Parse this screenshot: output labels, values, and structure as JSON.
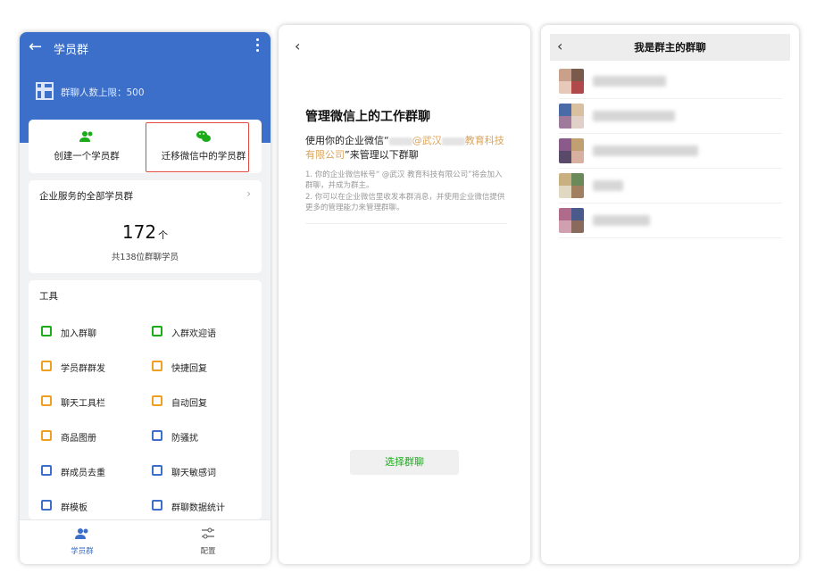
{
  "panel1": {
    "title": "学员群",
    "limit_text": "群聊人数上限：500",
    "actions": [
      {
        "label": "创建一个学员群",
        "icon": "add-group-icon"
      },
      {
        "label": "迁移微信中的学员群",
        "icon": "wechat-icon"
      }
    ],
    "stats": {
      "title": "企业服务的全部学员群",
      "count": "172",
      "unit": "个",
      "sub": "共138位群聊学员"
    },
    "tools_title": "工具",
    "tools": [
      {
        "label": "加入群聊",
        "icon": "qr-join-icon",
        "color": "#1aad19"
      },
      {
        "label": "入群欢迎语",
        "icon": "welcome-chat-icon",
        "color": "#1aad19"
      },
      {
        "label": "学员群群发",
        "icon": "broadcast-icon",
        "color": "#f0a020"
      },
      {
        "label": "快捷回复",
        "icon": "quick-reply-icon",
        "color": "#f0a020"
      },
      {
        "label": "聊天工具栏",
        "icon": "toolbar-icon",
        "color": "#f0a020"
      },
      {
        "label": "自动回复",
        "icon": "auto-reply-icon",
        "color": "#f0a020"
      },
      {
        "label": "商品图册",
        "icon": "catalog-icon",
        "color": "#f0a020"
      },
      {
        "label": "防骚扰",
        "icon": "anti-harass-icon",
        "color": "#3b6fc9"
      },
      {
        "label": "群成员去重",
        "icon": "dedupe-icon",
        "color": "#3b6fc9"
      },
      {
        "label": "聊天敏感词",
        "icon": "sensitive-word-icon",
        "color": "#3b6fc9"
      },
      {
        "label": "群模板",
        "icon": "template-icon",
        "color": "#3b6fc9"
      },
      {
        "label": "群聊数据统计",
        "icon": "stats-icon",
        "color": "#3b6fc9"
      }
    ],
    "tabs": [
      {
        "label": "学员群",
        "icon": "people-icon",
        "active": true,
        "color": "#3b6fc9"
      },
      {
        "label": "配置",
        "icon": "settings-sliders-icon",
        "active": false,
        "color": "#555555"
      }
    ],
    "colors": {
      "header": "#3b6fc9",
      "highlight_border": "#e04a3f"
    }
  },
  "panel2": {
    "title": "管理微信上的工作群聊",
    "desc_prefix": "使用你的企业微信“",
    "desc_org_1": "@武汉",
    "desc_org_2": "教育科技有限公司",
    "desc_suffix": "”来管理以下群聊",
    "note1": "1. 你的企业微信帐号“         @武汉         教育科技有限公司”将会加入群聊，并成为群主。",
    "note2": "2. 你可以在企业微信里收发本群消息，并使用企业微信提供更多的管理能力来管理群聊。",
    "button": "选择群聊",
    "colors": {
      "org_text": "#d9a45b",
      "button_text": "#1aad19"
    }
  },
  "panel3": {
    "title": "我是群主的群聊",
    "groups": [
      {
        "name_blurred": true
      },
      {
        "name_blurred": true
      },
      {
        "name_blurred": true
      },
      {
        "name_blurred": true
      },
      {
        "name_blurred": true
      }
    ]
  }
}
